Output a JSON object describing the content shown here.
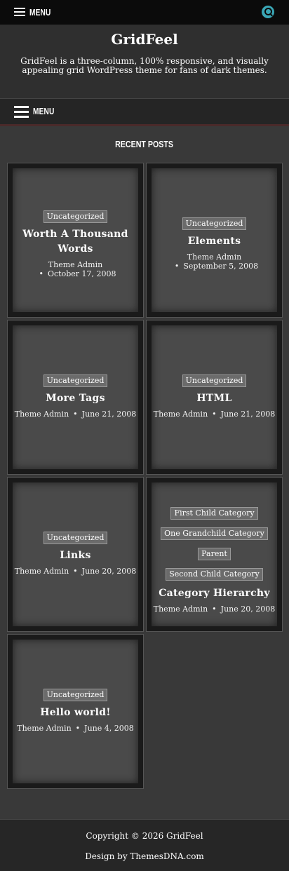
{
  "topbar": {
    "menu_label": "MENU"
  },
  "site": {
    "title": "GridFeel",
    "description": "GridFeel is a three-column, 100% responsive, and visually appealing grid WordPress theme for fans of dark themes."
  },
  "nav": {
    "menu_label": "MENU"
  },
  "section": {
    "title": "RECENT POSTS"
  },
  "posts": [
    {
      "tags": [
        "Uncategorized"
      ],
      "title": "Worth A Thousand Words",
      "author": "Theme Admin",
      "date": "October 17, 2008"
    },
    {
      "tags": [
        "Uncategorized"
      ],
      "title": "Elements",
      "author": "Theme Admin",
      "date": "September 5, 2008"
    },
    {
      "tags": [
        "Uncategorized"
      ],
      "title": "More Tags",
      "author": "Theme Admin",
      "date": "June 21, 2008"
    },
    {
      "tags": [
        "Uncategorized"
      ],
      "title": "HTML",
      "author": "Theme Admin",
      "date": "June 21, 2008"
    },
    {
      "tags": [
        "Uncategorized"
      ],
      "title": "Links",
      "author": "Theme Admin",
      "date": "June 20, 2008"
    },
    {
      "tags": [
        "First Child Category",
        "One Grandchild Category",
        "Parent",
        "Second Child Category"
      ],
      "title": "Category Hierarchy",
      "author": "Theme Admin",
      "date": "June 20, 2008"
    },
    {
      "tags": [
        "Uncategorized"
      ],
      "title": "Hello world!",
      "author": "Theme Admin",
      "date": "June 4, 2008"
    }
  ],
  "footer": {
    "copyright": "Copyright © 2026 GridFeel",
    "credit": "Design by ThemesDNA.com"
  }
}
